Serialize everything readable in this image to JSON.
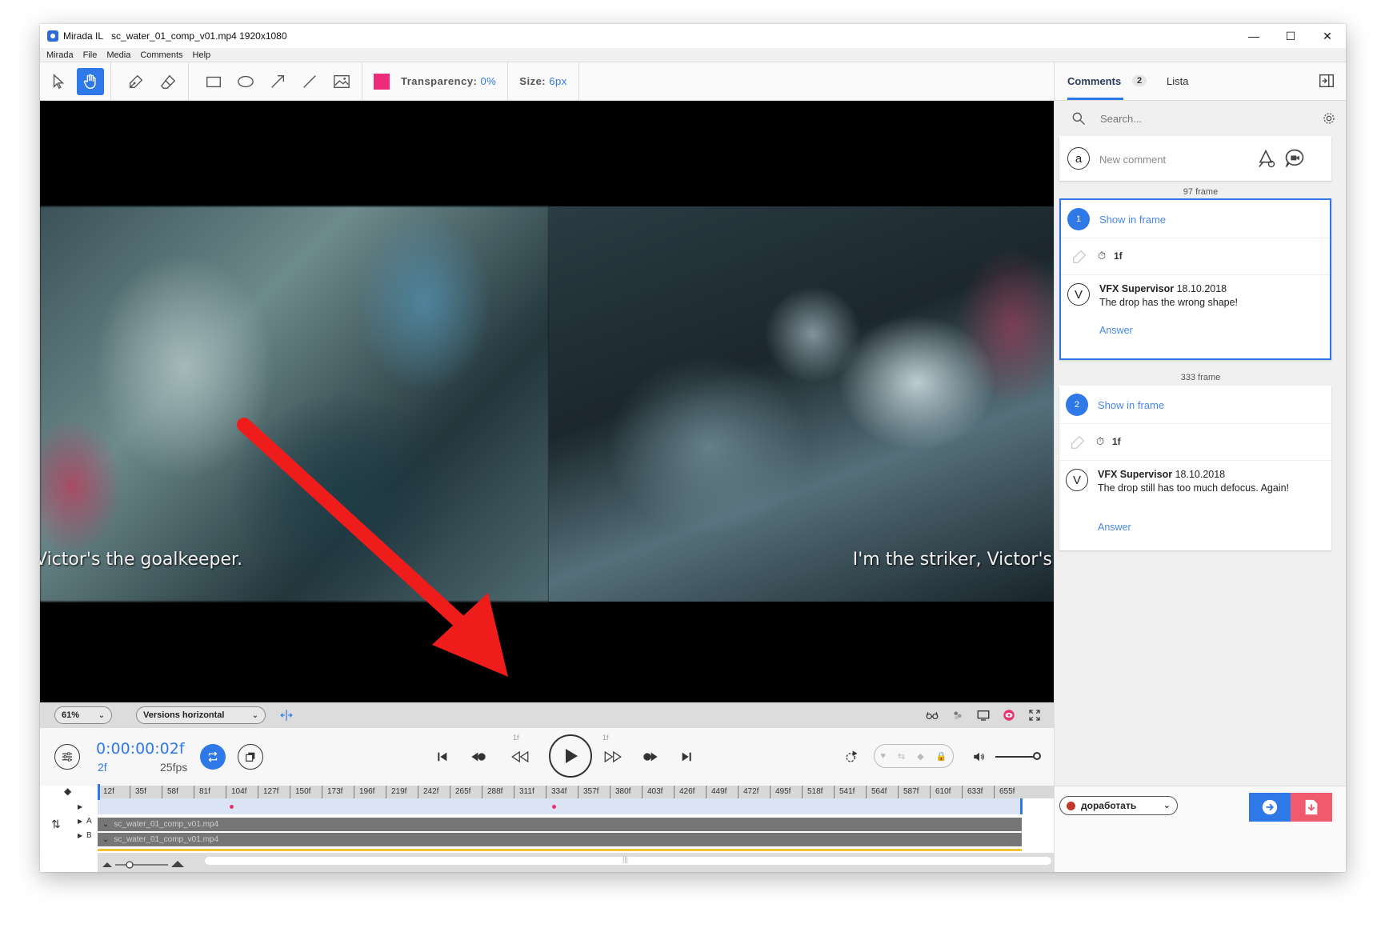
{
  "window": {
    "app_name": "Mirada IL",
    "file_title": "sc_water_01_comp_v01.mp4 1920x1080",
    "minimize": "—",
    "maximize": "☐",
    "close": "✕"
  },
  "menu": [
    "Mirada",
    "File",
    "Media",
    "Comments",
    "Help"
  ],
  "toolbar": {
    "color": "#ee2a7b",
    "transparency_label": "Transparency:",
    "transparency_value": "0%",
    "size_label": "Size:",
    "size_value": "6px"
  },
  "viewer": {
    "subtitle_left": "Victor's the goalkeeper.",
    "subtitle_right": "I'm the striker, Victor's"
  },
  "view_bar": {
    "zoom": "61%",
    "layout": "Versions horizontal"
  },
  "transport": {
    "timecode": "0:00:00:02f",
    "frame": "2f",
    "fps": "25fps",
    "step_back_label": "1f",
    "step_fwd_label": "1f"
  },
  "timeline": {
    "ticks": [
      "12f",
      "35f",
      "58f",
      "81f",
      "104f",
      "127f",
      "150f",
      "173f",
      "196f",
      "219f",
      "242f",
      "265f",
      "288f",
      "311f",
      "334f",
      "357f",
      "380f",
      "403f",
      "426f",
      "449f",
      "472f",
      "495f",
      "518f",
      "541f",
      "564f",
      "587f",
      "610f",
      "633f",
      "655f"
    ],
    "track_a": "sc_water_01_comp_v01.mp4",
    "track_b": "sc_water_01_comp_v01.mp4",
    "track_a_label": "A",
    "track_b_label": "B",
    "scroll_grip": "|||"
  },
  "comments_panel": {
    "tab_comments": "Comments",
    "count": "2",
    "tab_list": "Lista",
    "search_placeholder": "Search...",
    "new_comment_avatar": "a",
    "new_comment_placeholder": "New comment",
    "comments": [
      {
        "frame_label": "97 frame",
        "number": "1",
        "show_in_frame": "Show in frame",
        "duration": "1f",
        "avatar": "V",
        "author": "VFX Supervisor",
        "date": "18.10.2018",
        "text": "The drop has the wrong shape!",
        "answer": "Answer"
      },
      {
        "frame_label": "333 frame",
        "number": "2",
        "show_in_frame": "Show in frame",
        "duration": "1f",
        "avatar": "V",
        "author": "VFX Supervisor",
        "date": "18.10.2018",
        "text": "The drop still has too much defocus. Again!",
        "answer": "Answer"
      }
    ],
    "status": "доработать"
  }
}
